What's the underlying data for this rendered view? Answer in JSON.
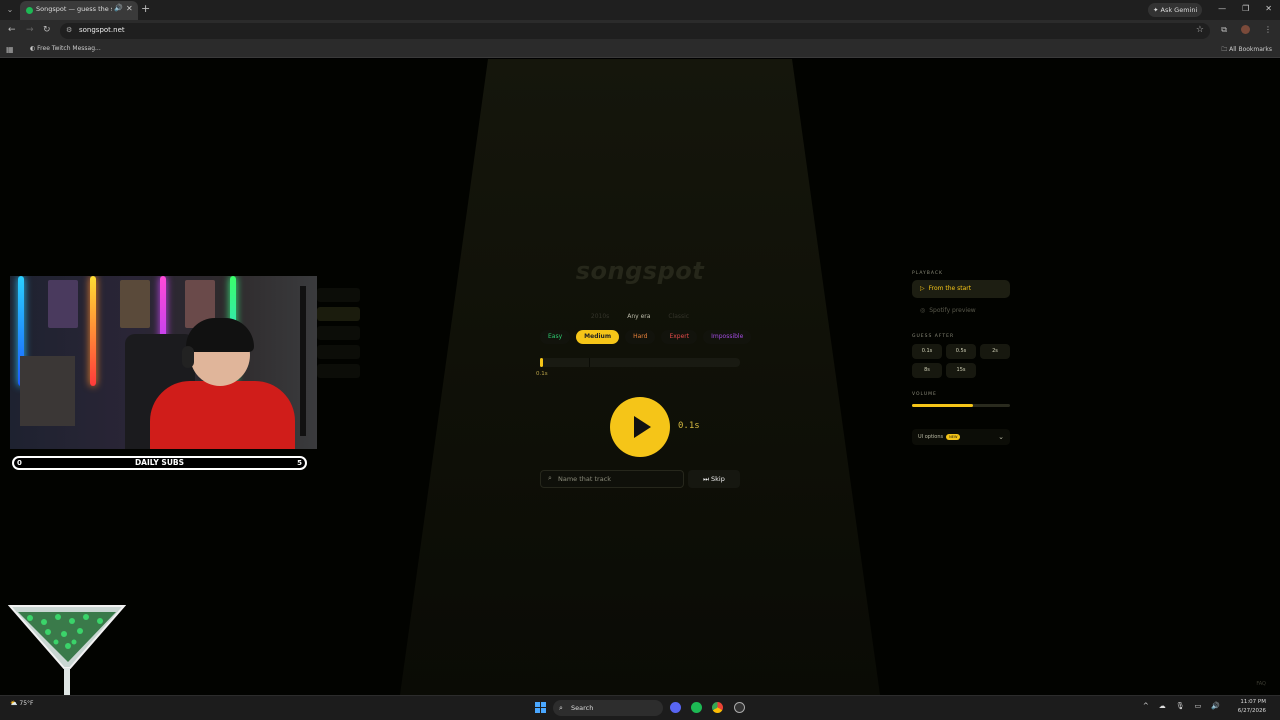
{
  "browser": {
    "tab_title": "Songspot — guess the son",
    "new_tab_glyph": "+",
    "gemini_label": "Ask Gemini",
    "url": "songspot.net",
    "bookmark_label": "Free Twitch Messag...",
    "all_bookmarks_label": "All Bookmarks"
  },
  "game": {
    "logo": "songspot",
    "eras": [
      {
        "label": "2010s",
        "active": false
      },
      {
        "label": "Any era",
        "active": true
      },
      {
        "label": "Classic",
        "active": false
      }
    ],
    "difficulties": {
      "easy": "Easy",
      "medium": "Medium",
      "hard": "Hard",
      "expert": "Expert",
      "impossible": "Impossible"
    },
    "selected_difficulty": "Medium",
    "progress_fraction": 0.015,
    "progress_label": "0.1s",
    "duration_display": "0.1s",
    "guess_placeholder": "Name that track",
    "skip_label": "Skip"
  },
  "sidebar": {
    "playback_heading": "PLAYBACK",
    "playback_options": {
      "from_start": "From the start",
      "spotify_preview": "Spotify preview"
    },
    "guess_after_heading": "GUESS AFTER",
    "guess_after_options": [
      "0.1s",
      "0.5s",
      "2s",
      "8s",
      "15s"
    ],
    "volume_heading": "VOLUME",
    "volume_fraction": 0.62,
    "ui_options_label": "UI options",
    "ui_options_badge": "NEW"
  },
  "faq_label": "FAQ",
  "overlay": {
    "subs_left": "0",
    "subs_title": "DAILY SUBS",
    "subs_right": "5"
  },
  "taskbar": {
    "weather": "75°F",
    "search_label": "Search",
    "time": "11:07 PM",
    "date": "6/27/2026"
  },
  "colors": {
    "accent": "#f5c518",
    "easy": "#2ecc71",
    "hard": "#e8823a",
    "expert": "#e24a4a",
    "impossible": "#a24be0"
  }
}
